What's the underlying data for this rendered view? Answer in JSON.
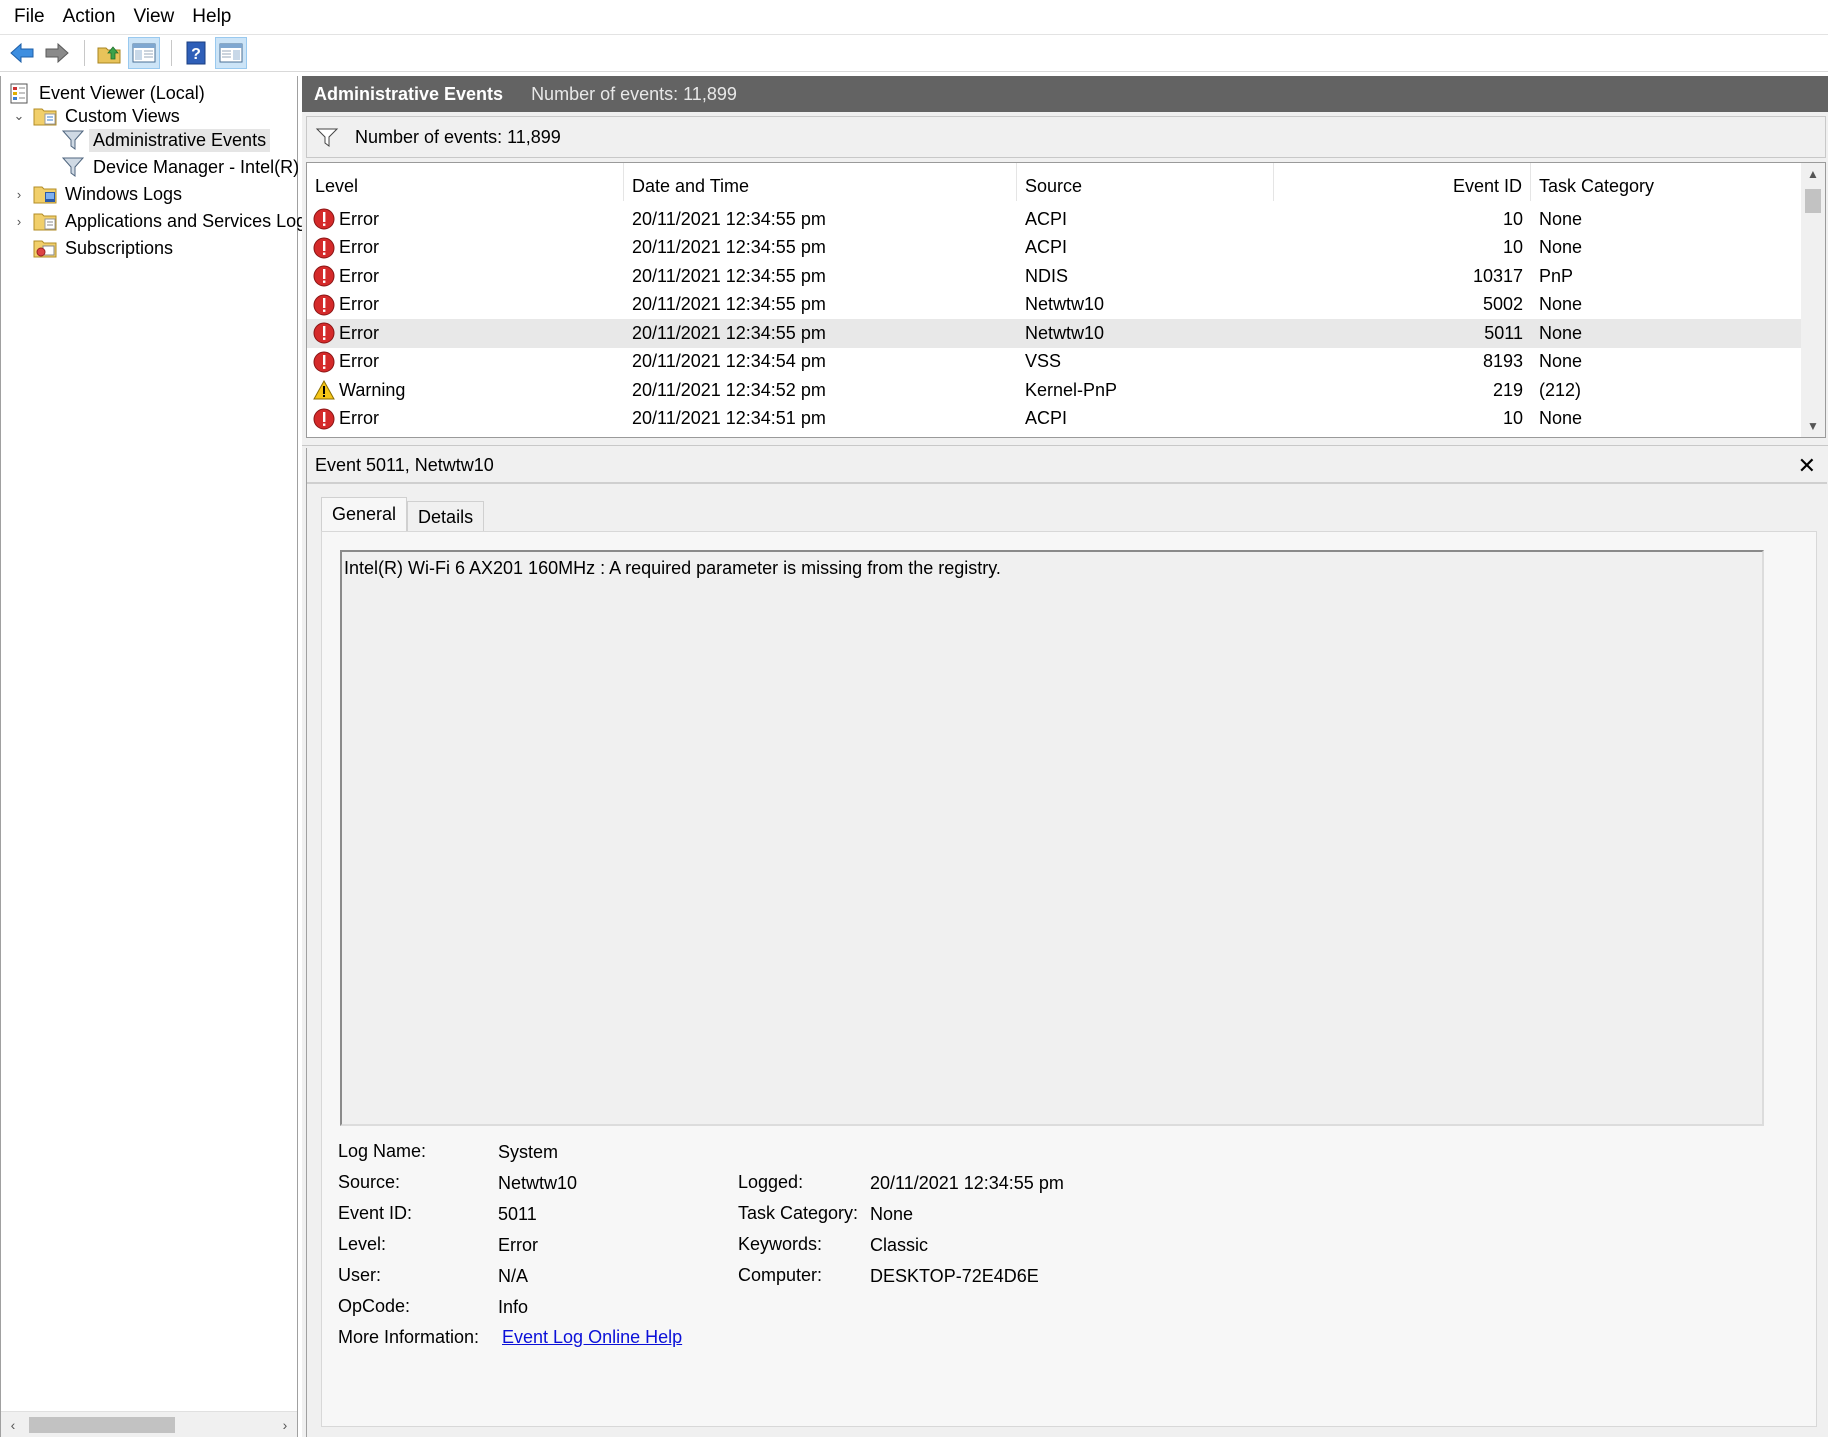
{
  "menu": [
    "File",
    "Action",
    "View",
    "Help"
  ],
  "toolbar": {
    "buttons": [
      "back-arrow-icon",
      "forward-arrow-icon",
      "up-folder-icon",
      "show-hide-console-tree-icon",
      "help-icon",
      "show-hide-action-pane-icon"
    ]
  },
  "tree": {
    "items": [
      {
        "label": "Event Viewer (Local)",
        "icon": "event-viewer-icon",
        "expander": ""
      },
      {
        "label": "Custom Views",
        "icon": "folder-icon",
        "expander": "⌄"
      },
      {
        "label": "Administrative Events",
        "icon": "filter-icon",
        "expander": ""
      },
      {
        "label": "Device Manager - Intel(R)",
        "icon": "filter-icon",
        "expander": ""
      },
      {
        "label": "Windows Logs",
        "icon": "folder-icon",
        "expander": "›"
      },
      {
        "label": "Applications and Services Log",
        "icon": "folder-icon",
        "expander": "›"
      },
      {
        "label": "Subscriptions",
        "icon": "subscriptions-icon",
        "expander": ""
      }
    ]
  },
  "header": {
    "title": "Administrative Events",
    "count": "Number of events: 11,899"
  },
  "filter_bar": {
    "count": "Number of events: 11,899"
  },
  "events": {
    "columns": [
      "Level",
      "Date and Time",
      "Source",
      "Event ID",
      "Task Category"
    ],
    "rows": [
      {
        "level": "Error",
        "datetime": "20/11/2021 12:34:55 pm",
        "source": "ACPI",
        "event_id": "10",
        "task": "None"
      },
      {
        "level": "Error",
        "datetime": "20/11/2021 12:34:55 pm",
        "source": "ACPI",
        "event_id": "10",
        "task": "None"
      },
      {
        "level": "Error",
        "datetime": "20/11/2021 12:34:55 pm",
        "source": "NDIS",
        "event_id": "10317",
        "task": "PnP"
      },
      {
        "level": "Error",
        "datetime": "20/11/2021 12:34:55 pm",
        "source": "Netwtw10",
        "event_id": "5002",
        "task": "None"
      },
      {
        "level": "Error",
        "datetime": "20/11/2021 12:34:55 pm",
        "source": "Netwtw10",
        "event_id": "5011",
        "task": "None"
      },
      {
        "level": "Error",
        "datetime": "20/11/2021 12:34:54 pm",
        "source": "VSS",
        "event_id": "8193",
        "task": "None"
      },
      {
        "level": "Warning",
        "datetime": "20/11/2021 12:34:52 pm",
        "source": "Kernel-PnP",
        "event_id": "219",
        "task": "(212)"
      },
      {
        "level": "Error",
        "datetime": "20/11/2021 12:34:51 pm",
        "source": "ACPI",
        "event_id": "10",
        "task": "None"
      }
    ],
    "selected_index": 4
  },
  "detail": {
    "title": "Event 5011, Netwtw10",
    "close_label": "✕",
    "tabs": [
      "General",
      "Details"
    ],
    "message": "Intel(R) Wi-Fi 6 AX201 160MHz : A required parameter is missing from the registry.",
    "fields": {
      "log_name_label": "Log Name:",
      "log_name": "System",
      "source_label": "Source:",
      "source": "Netwtw10",
      "logged_label": "Logged:",
      "logged": "20/11/2021 12:34:55 pm",
      "event_id_label": "Event ID:",
      "event_id": "5011",
      "task_category_label": "Task Category:",
      "task_category": "None",
      "level_label": "Level:",
      "level": "Error",
      "keywords_label": "Keywords:",
      "keywords": "Classic",
      "user_label": "User:",
      "user": "N/A",
      "computer_label": "Computer:",
      "computer": "DESKTOP-72E4D6E",
      "opcode_label": "OpCode:",
      "opcode": "Info",
      "more_info_label": "More Information:",
      "more_info_link": "Event Log Online Help"
    }
  }
}
